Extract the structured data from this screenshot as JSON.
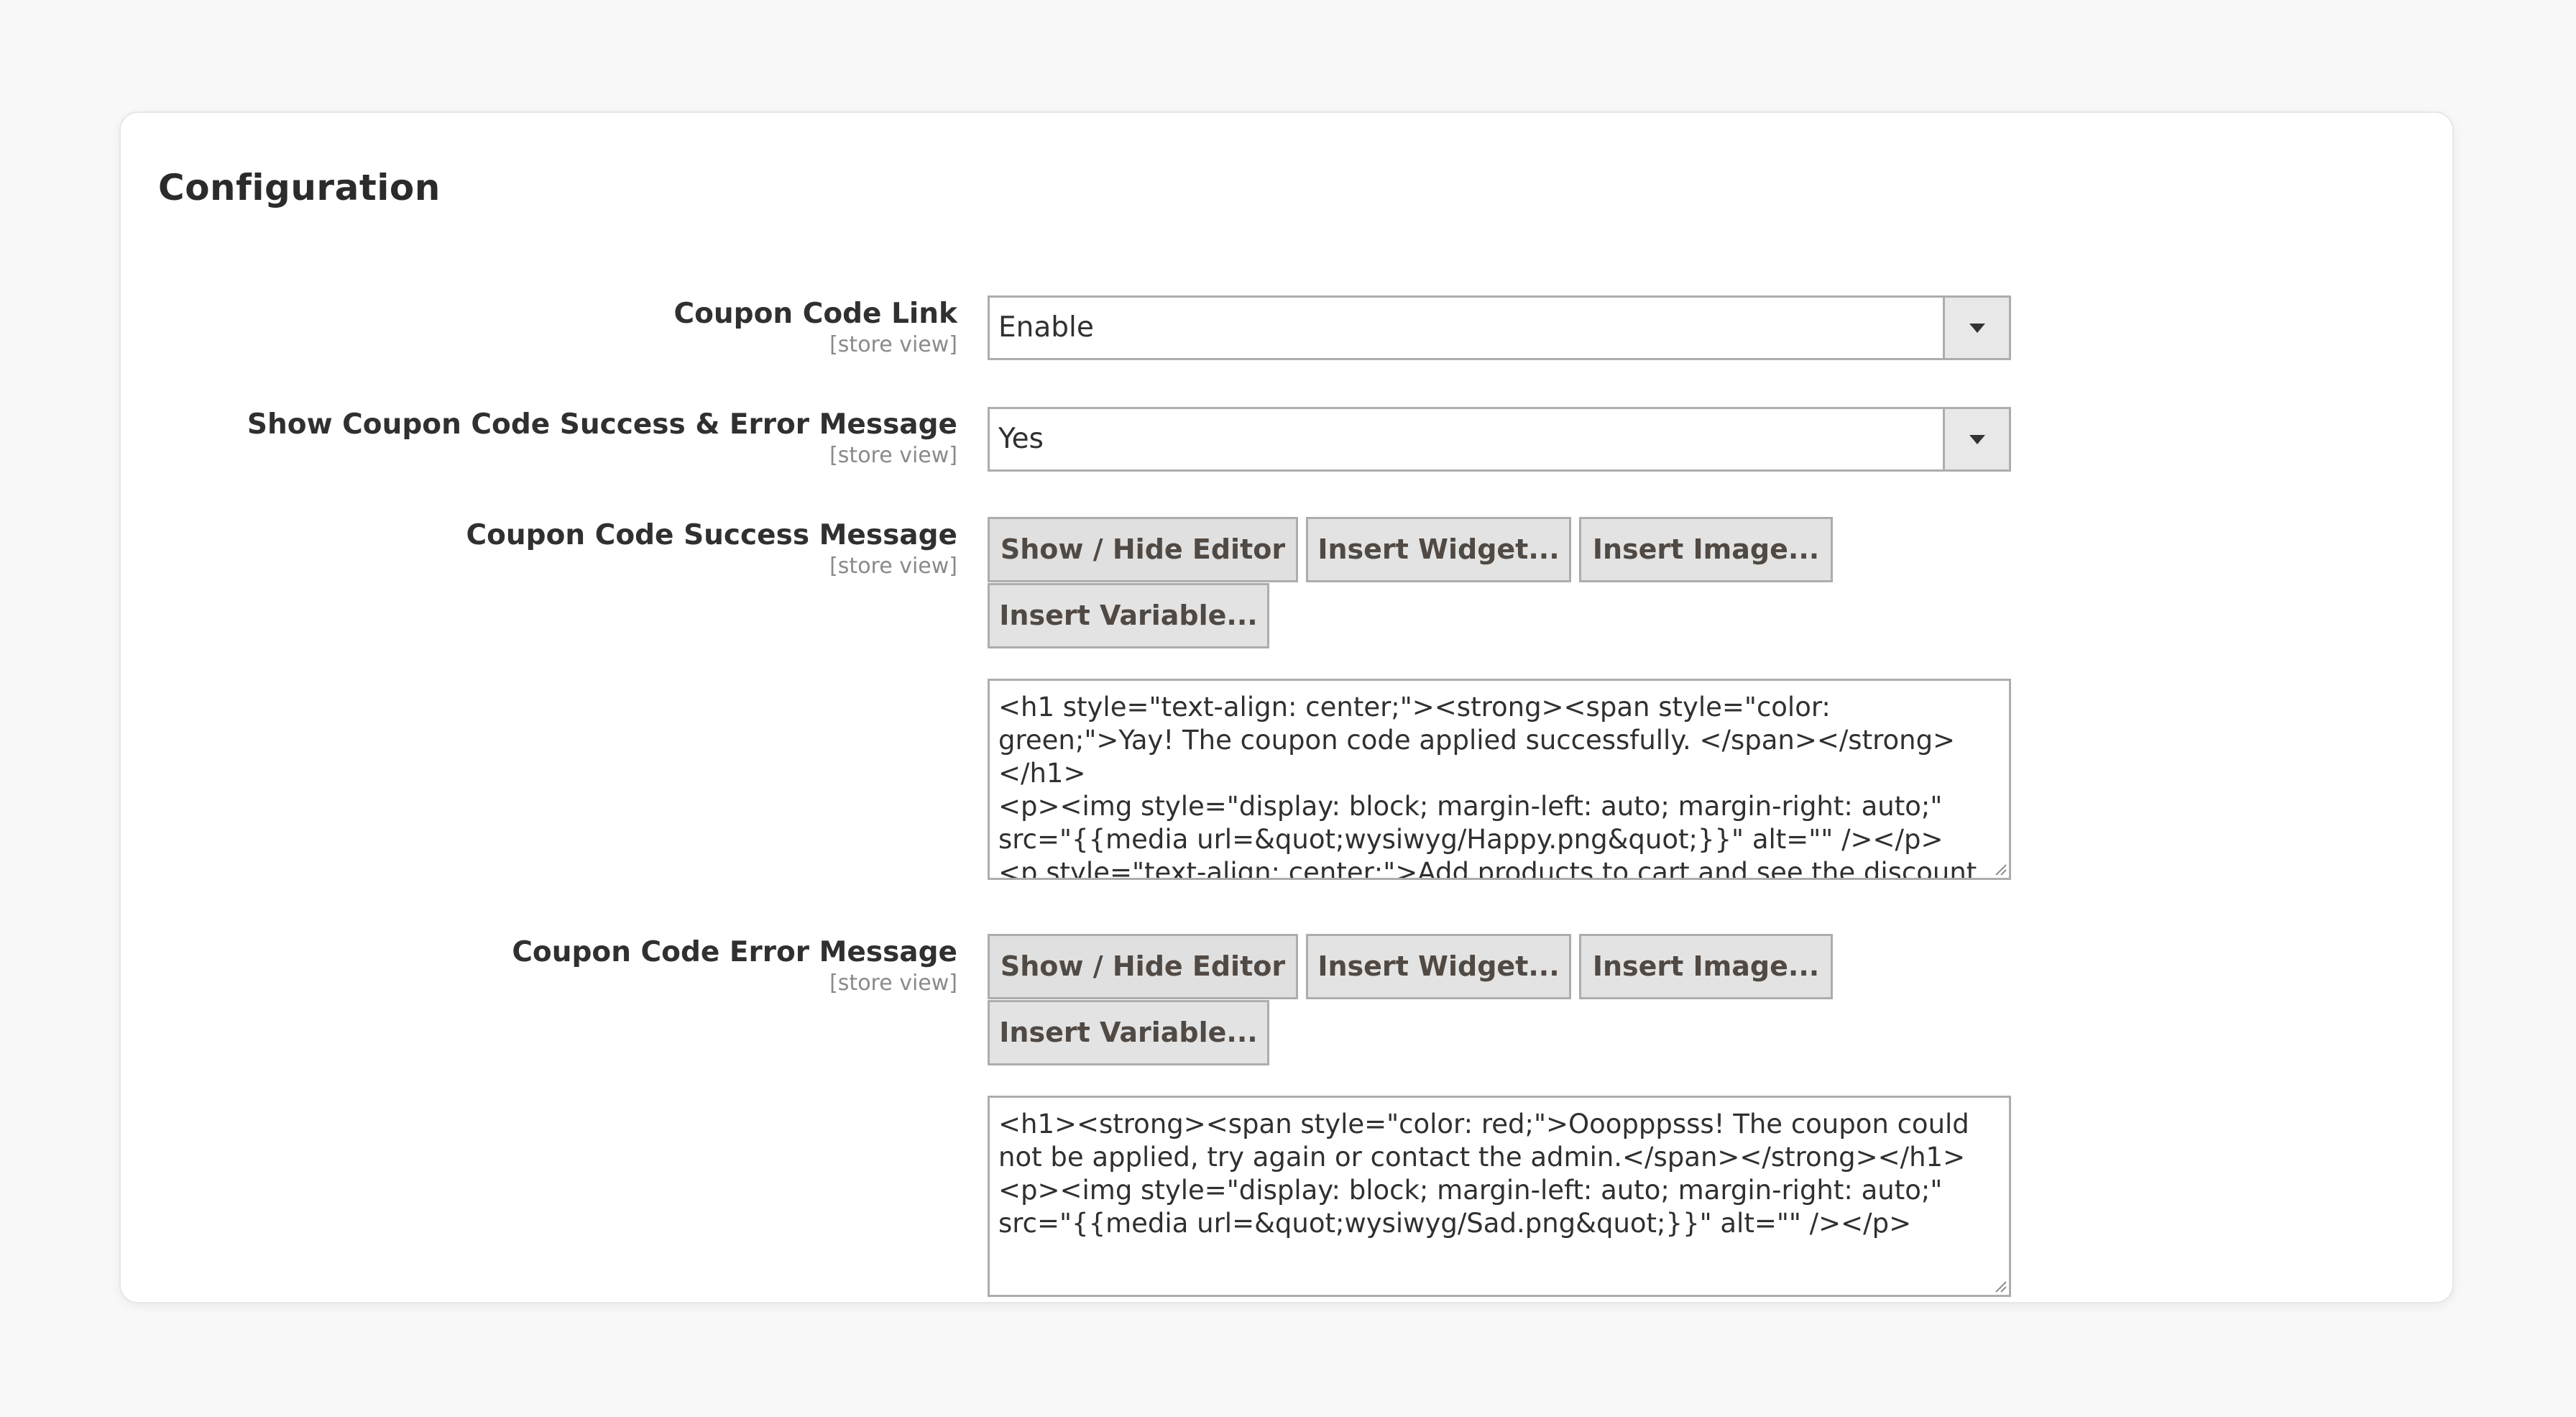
{
  "section": {
    "title": "Configuration"
  },
  "fields": {
    "coupon_link": {
      "label": "Coupon Code Link",
      "scope": "[store view]",
      "value": "Enable"
    },
    "show_messages": {
      "label": "Show Coupon Code Success & Error Message",
      "scope": "[store view]",
      "value": "Yes"
    },
    "success_message": {
      "label": "Coupon Code Success Message",
      "scope": "[store view]",
      "buttons": {
        "show_hide": "Show / Hide Editor",
        "insert_widget": "Insert Widget...",
        "insert_image": "Insert Image...",
        "insert_variable": "Insert Variable..."
      },
      "content": "<h1 style=\"text-align: center;\"><strong><span style=\"color: green;\">Yay! The coupon code applied successfully. </span></strong></h1>\n<p><img style=\"display: block; margin-left: auto; margin-right: auto;\" src=\"{{media url=&quot;wysiwyg/Happy.png&quot;}}\" alt=\"\" /></p>\n<p style=\"text-align: center;\">Add products to cart and see the discount applied automatically!</p>"
    },
    "error_message": {
      "label": "Coupon Code Error Message",
      "scope": "[store view]",
      "buttons": {
        "show_hide": "Show / Hide Editor",
        "insert_widget": "Insert Widget...",
        "insert_image": "Insert Image...",
        "insert_variable": "Insert Variable..."
      },
      "content": "<h1><strong><span style=\"color: red;\">Ooopppsss! The coupon could not be applied, try again or contact the admin.</span></strong></h1>\n<p><img style=\"display: block; margin-left: auto; margin-right: auto;\" src=\"{{media url=&quot;wysiwyg/Sad.png&quot;}}\" alt=\"\" /></p>"
    }
  },
  "icons": {
    "select_arrow": "chevron-down-icon",
    "resize_handle": "resize-grip-icon"
  }
}
